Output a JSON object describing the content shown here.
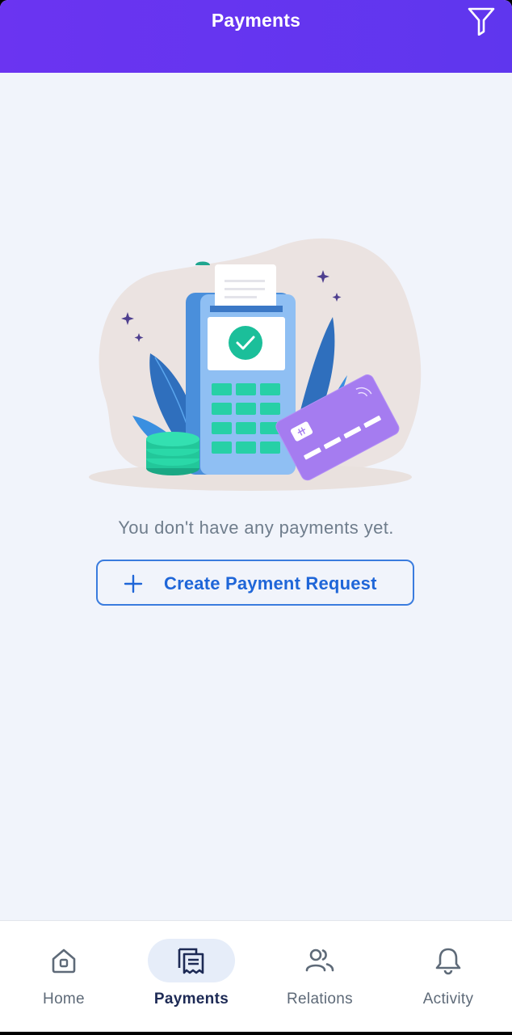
{
  "header": {
    "title": "Payments",
    "filter_icon": "filter-icon"
  },
  "empty_state": {
    "illustration": "payment-terminal-illustration",
    "message": "You don't have any payments yet.",
    "create_button_label": "Create Payment Request",
    "create_button_icon": "plus-icon"
  },
  "bottom_nav": {
    "items": [
      {
        "label": "Home",
        "icon": "home-icon",
        "active": false
      },
      {
        "label": "Payments",
        "icon": "receipt-icon",
        "active": true
      },
      {
        "label": "Relations",
        "icon": "users-icon",
        "active": false
      },
      {
        "label": "Activity",
        "icon": "bell-icon",
        "active": false
      }
    ]
  },
  "colors": {
    "header": "#6238f0",
    "accent_blue": "#1f66d8",
    "background": "#f1f4fb",
    "nav_active_bg": "#e6edf9"
  }
}
